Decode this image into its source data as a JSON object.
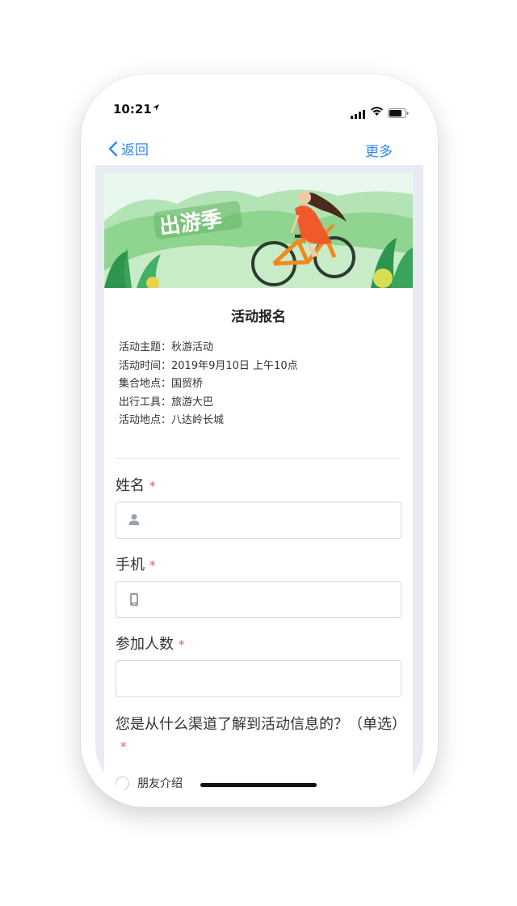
{
  "status_bar": {
    "time": "10:21"
  },
  "nav": {
    "back_label": "返回",
    "more_label": "更多"
  },
  "banner": {
    "text": "出游季"
  },
  "form": {
    "title": "活动报名",
    "info": [
      {
        "label": "活动主题：",
        "value": "秋游活动"
      },
      {
        "label": "活动时间：",
        "value": "2019年9月10日 上午10点"
      },
      {
        "label": "集合地点：",
        "value": "国贸桥"
      },
      {
        "label": "出行工具：",
        "value": "旅游大巴"
      },
      {
        "label": "活动地点：",
        "value": "八达岭长城"
      }
    ],
    "fields": {
      "name_label": "姓名",
      "phone_label": "手机",
      "count_label": "参加人数",
      "required_mark": "*"
    },
    "question": {
      "label": "您是从什么渠道了解到活动信息的？（单选）",
      "options": [
        "朋友介绍"
      ]
    }
  },
  "colors": {
    "accent": "#2f89f3",
    "required": "#e9547a",
    "background": "#e8ecf2"
  }
}
